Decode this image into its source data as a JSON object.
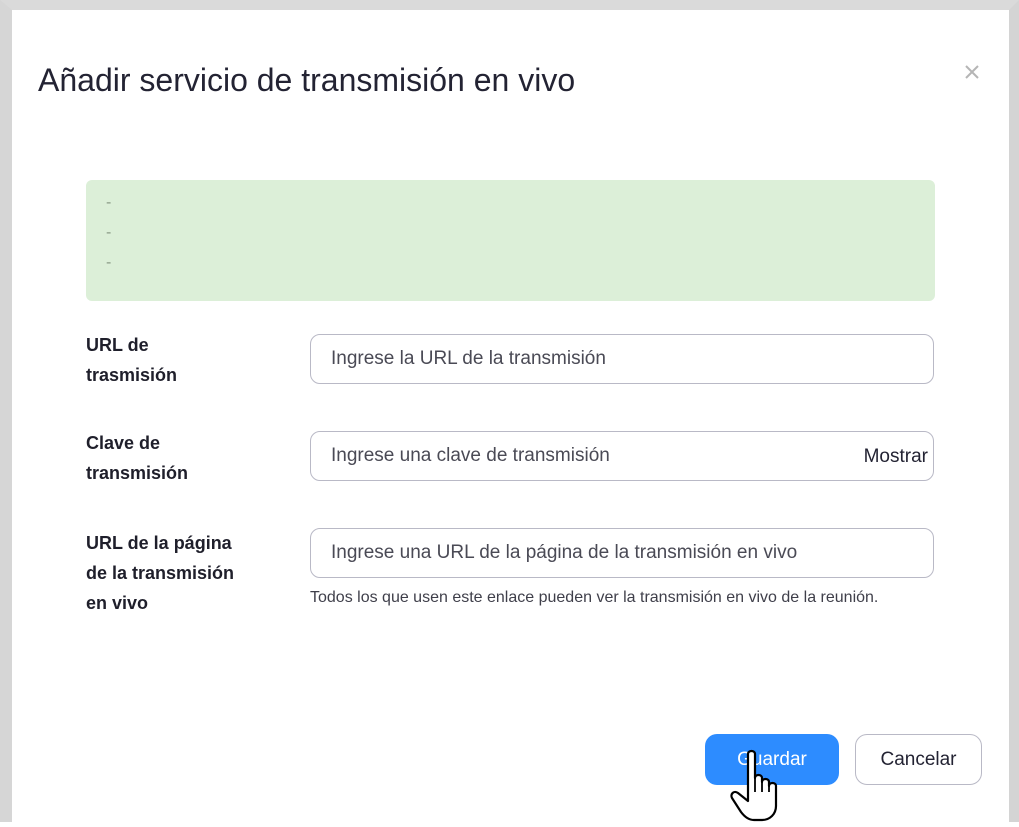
{
  "dialog": {
    "title": "Añadir servicio de transmisión en vivo",
    "close_icon": "close-icon"
  },
  "notice": {
    "lines": [
      "-",
      "-",
      "-"
    ],
    "background": "#dcefd8"
  },
  "form": {
    "stream_url": {
      "label_line1": "URL de",
      "label_line2": "trasmisión",
      "placeholder": "Ingrese la URL de la transmisión"
    },
    "stream_key": {
      "label_line1": "Clave de",
      "label_line2": "transmisión",
      "placeholder": "Ingrese una clave de transmisión",
      "show_label": "Mostrar"
    },
    "page_url": {
      "label_line1": "URL de la página",
      "label_line2": "de la transmisión",
      "label_line3": "en vivo",
      "placeholder": "Ingrese una URL de la página de la transmisión en vivo",
      "helper_text": "Todos los que usen este enlace pueden ver la transmisión en vivo de la reunión."
    }
  },
  "buttons": {
    "save_label": "Guardar",
    "cancel_label": "Cancelar",
    "primary_color": "#2d8cff"
  },
  "cursor_icon": "hand-pointer-icon"
}
